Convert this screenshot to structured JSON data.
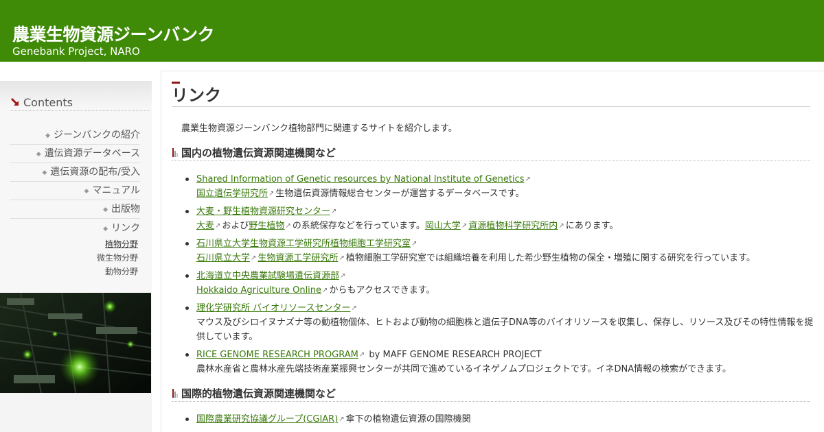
{
  "header": {
    "title": "農業生物資源ジーンバンク",
    "subtitle": "Genebank Project, NARO",
    "bg_color": "#3f8a06"
  },
  "sidebar": {
    "heading": "Contents",
    "heading_icon": "arrow-down-right-icon",
    "items": [
      {
        "label": "ジーンバンクの紹介"
      },
      {
        "label": "遺伝資源データベース"
      },
      {
        "label": "遺伝資源の配布/受入"
      },
      {
        "label": "マニュアル"
      },
      {
        "label": "出版物"
      },
      {
        "label": "リンク"
      }
    ],
    "sub_items": [
      {
        "label": "植物分野",
        "active": true
      },
      {
        "label": "微生物分野",
        "active": false
      },
      {
        "label": "動物分野",
        "active": false
      }
    ]
  },
  "main": {
    "page_title": "リンク",
    "intro": "農業生物資源ジーンバンク植物部門に関連するサイトを紹介します。",
    "link_color": "#3a7a0c",
    "sections": [
      {
        "heading": "国内の植物遺伝資源関連機関など",
        "entries": [
          {
            "title": "Shared Information of Genetic resources by National Institute of Genetics",
            "desc_link": "国立遺伝学研究所",
            "desc": "生物遺伝資源情報総合センターが運営するデータベースです。"
          },
          {
            "title": "大麦・野生植物資源研究センター",
            "link1": "大麦",
            "text1": "および",
            "link2": "野生植物",
            "text2": "の系統保存などを行っています。",
            "link3": "岡山大学",
            "link4": "資源植物科学研究所内",
            "text3": "にあります。"
          },
          {
            "title": "石川県立大学生物資源工学研究所植物細胞工学研究室",
            "link1": "石川県立大学",
            "link2": "生物資源工学研究所",
            "desc": "植物細胞工学研究室では組織培養を利用した希少野生植物の保全・増殖に関する研究を行っています。"
          },
          {
            "title": "北海道立中央農業試験場遺伝資源部",
            "desc_link": "Hokkaido Agriculture Online",
            "desc": "からもアクセスできます。"
          },
          {
            "title": "理化学研究所 バイオリソースセンター",
            "desc": "マウス及びシロイヌナズナ等の動植物個体、ヒトおよび動物の細胞株と遺伝子DNA等のバイオリソースを収集し、保存し、リソース及びその特性情報を提供しています。"
          },
          {
            "title": "RICE GENOME RESEARCH PROGRAM",
            "title_suffix": " by MAFF GENOME RESEARCH PROJECT",
            "desc": "農林水産省と農林水産先端技術産業振興センターが共同で進めているイネゲノムプロジェクトです。イネDNA情報の検索ができます。"
          }
        ]
      },
      {
        "heading": "国際的植物遺伝資源関連機関など",
        "entries": [
          {
            "title": "国際農業研究協議グループ(CGIAR)",
            "title_suffix": "傘下の植物遺伝資源の国際機関"
          }
        ]
      }
    ]
  }
}
